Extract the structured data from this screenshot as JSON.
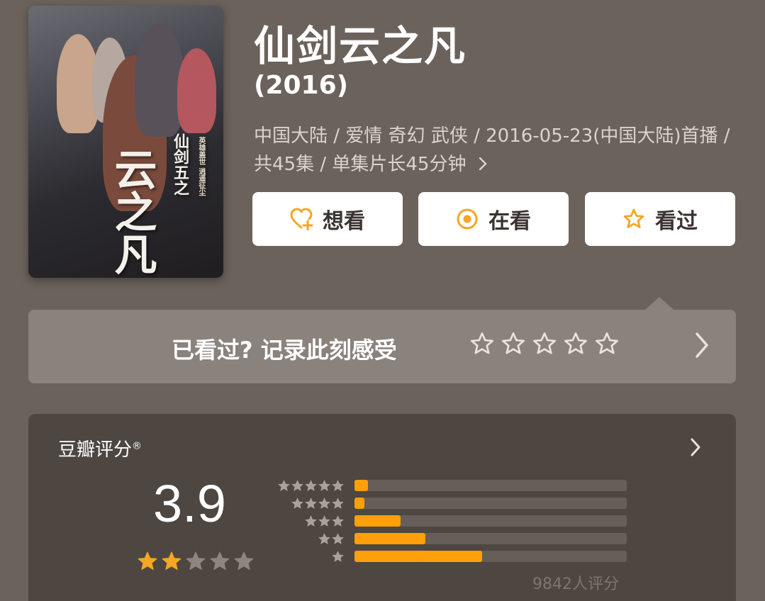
{
  "poster": {
    "calligraphy_main": "云之凡",
    "calligraphy_series": "仙剑五之",
    "calligraphy_tagline": "英雄盖世 逍遥征尘"
  },
  "header": {
    "title": "仙剑云之凡",
    "year": "(2016)",
    "meta": "中国大陆 / 爱情 奇幻 武侠 / 2016-05-23(中国大陆)首播 / 共45集 / 单集片长45分钟"
  },
  "actions": {
    "want": "想看",
    "watching": "在看",
    "watched": "看过"
  },
  "record": {
    "label": "已看过? 记录此刻感受",
    "star_count": 5
  },
  "rating": {
    "title": "豆瓣评分",
    "registered_mark": "®",
    "score": "3.9",
    "score_stars": 2,
    "score_stars_max": 5,
    "distribution": [
      {
        "stars": 5,
        "percent": 5
      },
      {
        "stars": 4,
        "percent": 3
      },
      {
        "stars": 3,
        "percent": 17
      },
      {
        "stars": 2,
        "percent": 26
      },
      {
        "stars": 1,
        "percent": 47
      }
    ],
    "count_text": "9842人评分"
  },
  "colors": {
    "background": "#6b625b",
    "accent_orange": "#ff9f0a",
    "star_gold": "#f5a623",
    "card_white": "#ffffff"
  }
}
